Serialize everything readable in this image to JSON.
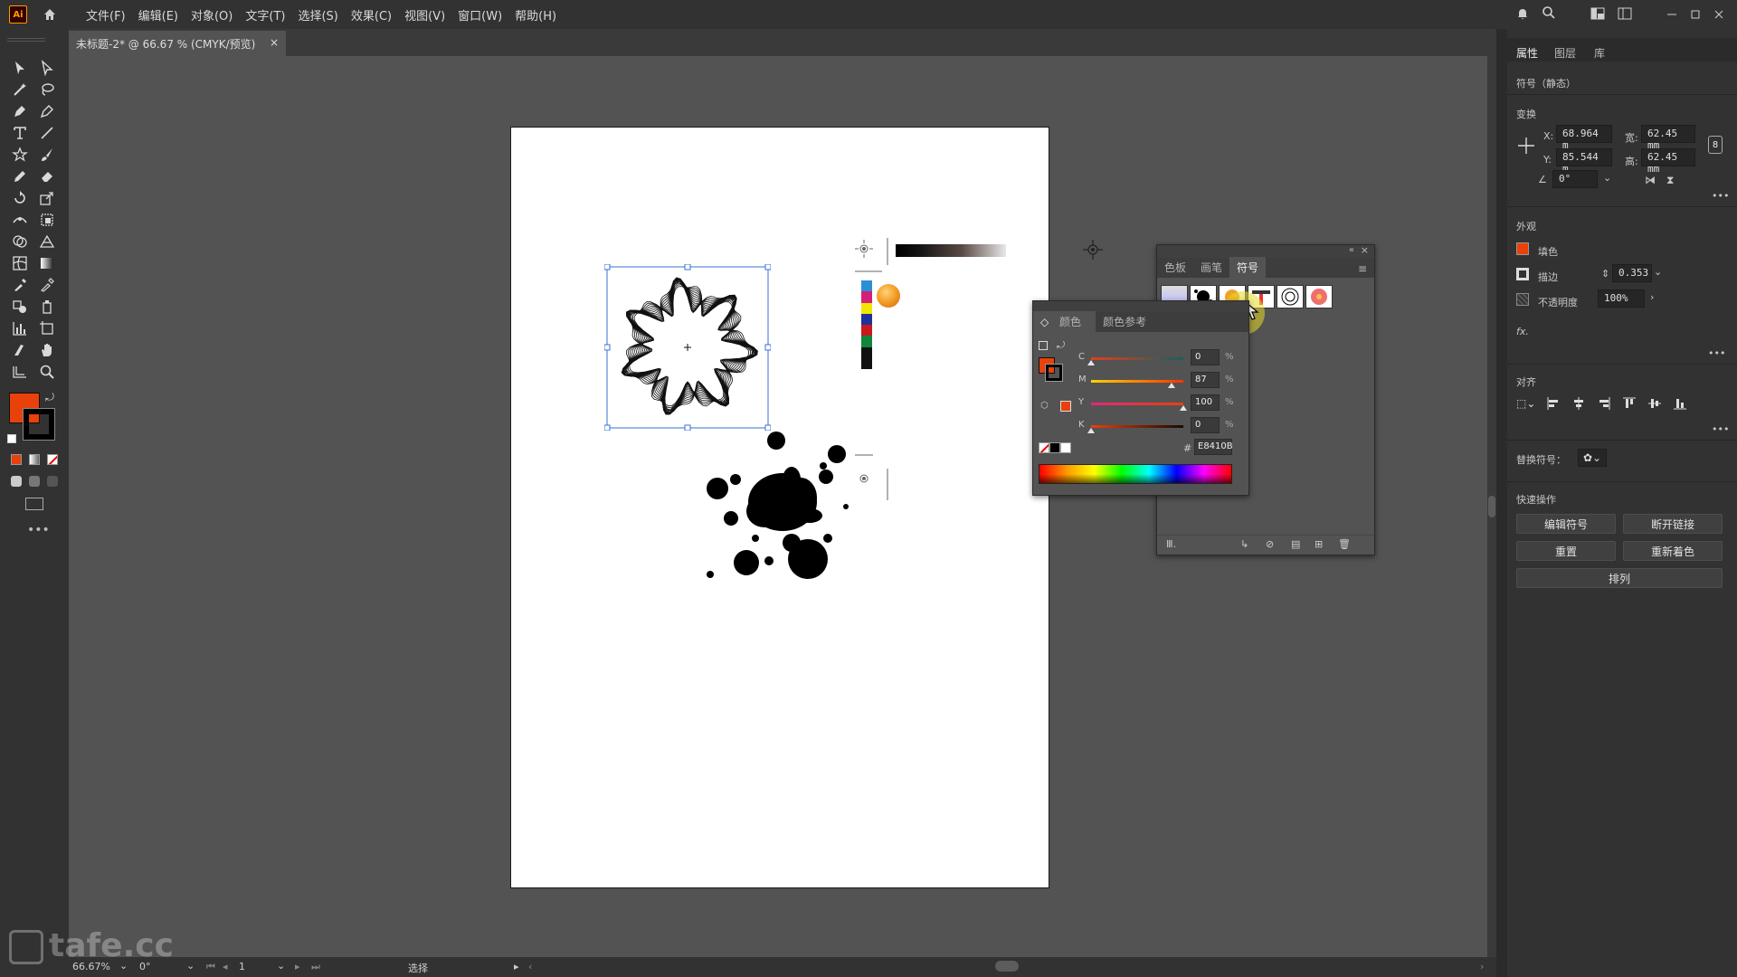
{
  "app": {
    "logo": "Ai"
  },
  "menus": [
    "文件(F)",
    "编辑(E)",
    "对象(O)",
    "文字(T)",
    "选择(S)",
    "效果(C)",
    "视图(V)",
    "窗口(W)",
    "帮助(H)"
  ],
  "document": {
    "tab_title": "未标题-2* @ 66.67 % (CMYK/预览)",
    "close": "×"
  },
  "colors": {
    "fill": "#E8410B",
    "accent": "#ff9a00"
  },
  "right_panel": {
    "tabs": [
      "属性",
      "图层",
      "库"
    ],
    "object_type": "符号（静态）",
    "transform": {
      "title": "变换",
      "x_label": "X:",
      "x": "68.964 m",
      "y_label": "Y:",
      "y": "85.544 m",
      "w_label": "宽:",
      "w": "62.45 mm",
      "h_label": "高:",
      "h": "62.45 mm",
      "angle": "0°"
    },
    "appearance": {
      "title": "外观",
      "fill_label": "填色",
      "stroke_label": "描边",
      "stroke_value": "0.353",
      "opacity_label": "不透明度",
      "opacity_value": "100%",
      "fx": "fx."
    },
    "align_title": "对齐",
    "replace_symbol_label": "替换符号：",
    "quick_actions": {
      "title": "快速操作",
      "edit_symbol": "编辑符号",
      "break_link": "断开链接",
      "reset": "重置",
      "recolor": "重新着色",
      "arrange": "排列"
    }
  },
  "symbols_panel": {
    "tabs": [
      "色板",
      "画笔",
      "符号"
    ]
  },
  "color_panel": {
    "tabs": [
      "颜色",
      "颜色参考"
    ],
    "channels": [
      {
        "label": "C",
        "value": "0",
        "pos": 0
      },
      {
        "label": "M",
        "value": "87",
        "pos": 87
      },
      {
        "label": "Y",
        "value": "100",
        "pos": 100
      },
      {
        "label": "K",
        "value": "0",
        "pos": 0
      }
    ],
    "percent": "%",
    "hex_label": "#",
    "hex": "E8410B"
  },
  "status": {
    "zoom": "66.67%",
    "rotation": "0°",
    "page": "1",
    "tool": "选择"
  },
  "watermark": "tafe.cc"
}
